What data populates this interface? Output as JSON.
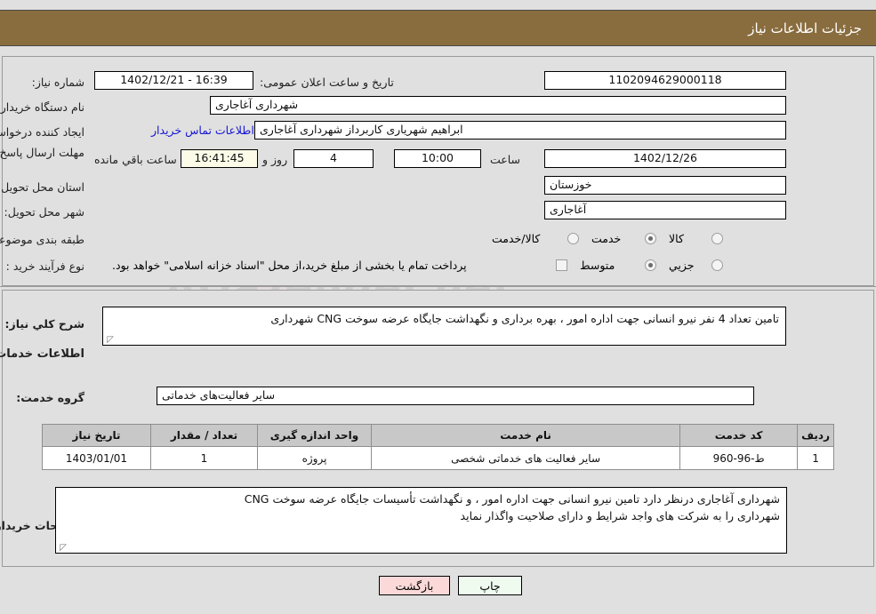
{
  "header": {
    "title": "جزئیات اطلاعات نیاز"
  },
  "form": {
    "need_number": {
      "label": "شماره نیاز:",
      "value": "1102094629000118"
    },
    "announce_datetime": {
      "label": "تاریخ و ساعت اعلان عمومی:",
      "value": "1402/12/21 - 16:39"
    },
    "buyer_org": {
      "label": "نام دستگاه خریدار:",
      "value": "شهرداری آغاجاری"
    },
    "requester": {
      "label": "ایجاد کننده درخواست:",
      "value": "ابراهیم شهریاری کاربرداز شهرداری آغاجاری"
    },
    "contact_link": "اطلاعات تماس خریدار",
    "deadline": {
      "label": "مهلت ارسال پاسخ: تا تاریخ:",
      "date": "1402/12/26",
      "hour_label": "ساعت",
      "hour": "10:00",
      "days": "4",
      "days_label": "روز و",
      "countdown": "16:41:45",
      "countdown_label": "ساعت باقي مانده"
    },
    "delivery_province": {
      "label": "استان محل تحویل:",
      "value": "خوزستان"
    },
    "delivery_city": {
      "label": "شهر محل تحویل:",
      "value": "آغاجاری"
    },
    "category": {
      "label": "طبقه بندی موضوعی:",
      "options": [
        {
          "label": "کالا",
          "selected": false
        },
        {
          "label": "خدمت",
          "selected": true
        },
        {
          "label": "کالا/خدمت",
          "selected": false
        }
      ]
    },
    "purchase_type": {
      "label": "نوع فرآیند خرید :",
      "options": [
        {
          "label": "جزیي",
          "selected": false
        },
        {
          "label": "متوسط",
          "selected": true
        }
      ],
      "checkbox_label": "پرداخت تمام یا بخشی از مبلغ خرید،از محل \"اسناد خزانه اسلامی\" خواهد بود.",
      "checkbox_checked": false
    }
  },
  "summary": {
    "label": "شرح کلي نیاز:",
    "value": "تامین تعداد 4 نفر نیرو انسانی جهت اداره امور ، بهره برداری و نگهداشت جایگاه عرضه سوخت CNG شهرداری"
  },
  "services_section": {
    "heading": "اطلاعات خدمات مورد نیاز",
    "group_label": "گروه خدمت:",
    "group_value": "سایر فعالیت‌های خدماتی"
  },
  "table": {
    "columns": [
      "ردیف",
      "کد خدمت",
      "نام خدمت",
      "واحد اندازه گیری",
      "تعداد / مقدار",
      "تاریخ نیاز"
    ],
    "rows": [
      [
        "1",
        "ط-96-960",
        "سایر فعالیت های خدماتی شخصی",
        "پروژه",
        "1",
        "1403/01/01"
      ]
    ]
  },
  "buyer_notes": {
    "label": "توضیحات خریدار:",
    "line1": "شهرداری آغاجاری درنظر دارد تامین نیرو انسانی جهت اداره امور ، و نگهداشت تأسیسات جایگاه عرضه سوخت CNG",
    "line2": "شهرداری را به شرکت های واجد شرایط و دارای صلاحیت واگذار نماید"
  },
  "footer": {
    "print_label": "چاپ",
    "back_label": "بازگشت"
  },
  "watermark": {
    "text": "AriaTender.net"
  },
  "colors": {
    "header_bg": "#8a6d3e",
    "link": "#1414d6",
    "back_button": "#fbd9d9",
    "print_button": "#eefbee",
    "countdown_bg": "#fbfbe8"
  }
}
